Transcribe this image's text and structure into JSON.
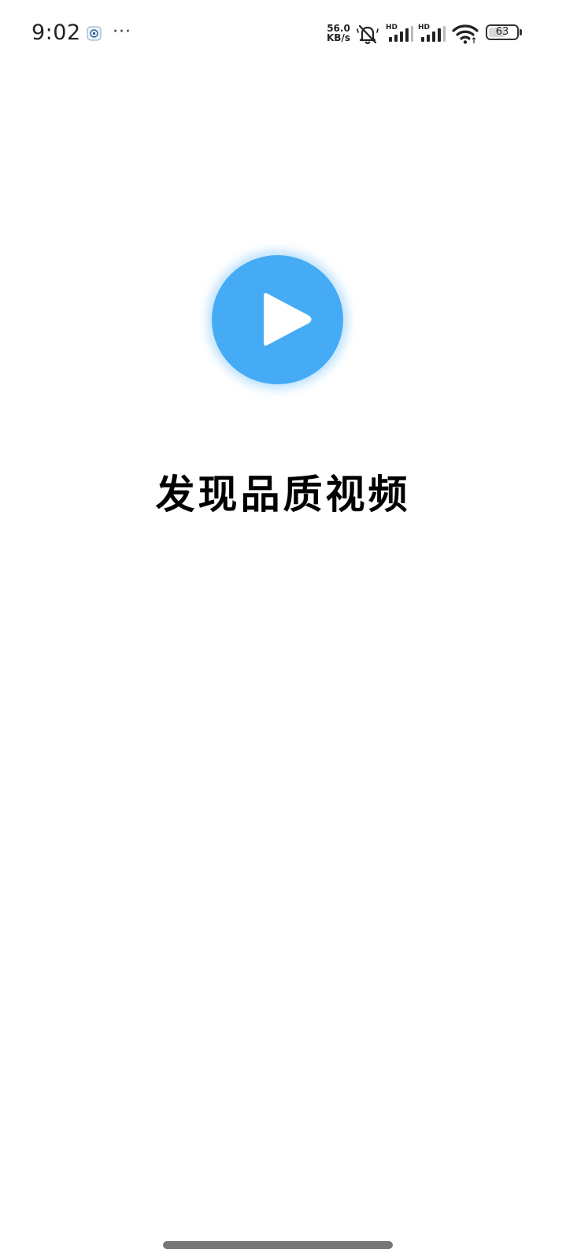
{
  "status_bar": {
    "time": "9:02",
    "more": "···",
    "net_speed_value": "56.0",
    "net_speed_unit": "KB/s",
    "signal_1_label": "HD",
    "signal_2_label": "HD",
    "battery_percent": "63",
    "battery_level": 0.63,
    "icons": {
      "notification": "app-notification-icon",
      "mute": "bell-muted-icon",
      "signal": "cell-signal-icon",
      "wifi": "wifi-icon",
      "battery": "battery-icon"
    }
  },
  "splash": {
    "logo_icon": "play-icon",
    "logo_color": "#45abf5",
    "slogan": "发现品质视频"
  }
}
